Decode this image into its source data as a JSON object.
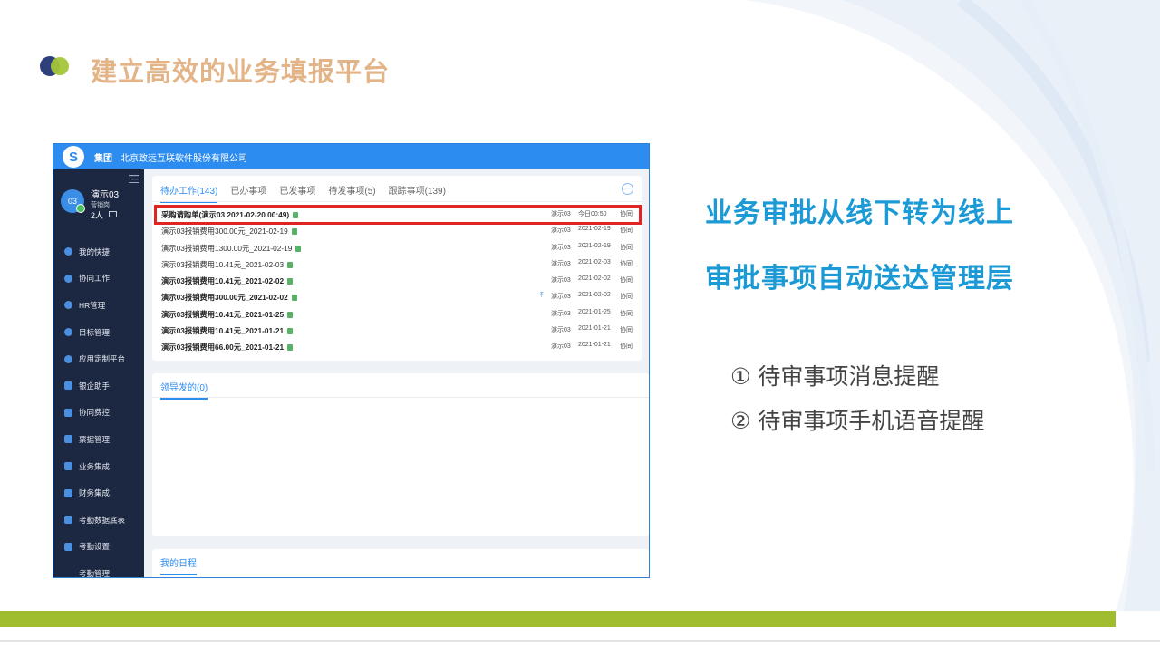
{
  "slide": {
    "title": "建立高效的业务填报平台",
    "headline_1": "业务审批从线下转为线上",
    "headline_2": "审批事项自动送达管理层",
    "bullets": [
      "① 待审事项消息提醒",
      "② 待审事项手机语音提醒"
    ]
  },
  "colors": {
    "title": "#e2b488",
    "headline": "#1b9ad6",
    "accent_bar": "#a0bd30",
    "app_blue": "#2d8cf0",
    "sidebar": "#1c2741",
    "highlight": "#e02424"
  },
  "app": {
    "logo_icon": "swirl-logo-icon",
    "group_label": "集团",
    "company": "北京致远互联软件股份有限公司",
    "user": {
      "avatar_text": "03",
      "name": "演示03",
      "dept": "营销岗",
      "count": "2人"
    },
    "menu": [
      {
        "label": "我的快捷",
        "icon": "shortcut-icon"
      },
      {
        "label": "协同工作",
        "icon": "collaboration-icon"
      },
      {
        "label": "HR管理",
        "icon": "hr-icon"
      },
      {
        "label": "目标管理",
        "icon": "target-icon"
      },
      {
        "label": "应用定制平台",
        "icon": "platform-icon"
      },
      {
        "label": "银企助手",
        "icon": "document-icon"
      },
      {
        "label": "协同费控",
        "icon": "cost-control-icon"
      },
      {
        "label": "票据管理",
        "icon": "document-icon"
      },
      {
        "label": "业务集成",
        "icon": "document-icon"
      },
      {
        "label": "财务集成",
        "icon": "document-icon"
      },
      {
        "label": "考勤数据底表",
        "icon": "cube-icon"
      },
      {
        "label": "考勤设置",
        "icon": "settings-form-icon"
      },
      {
        "label": "考勤管理",
        "icon": ""
      }
    ],
    "tabs": [
      "待办工作(143)",
      "已办事项",
      "已发事项",
      "待发事项(5)",
      "跟踪事项(139)"
    ],
    "more_label": "···",
    "pending_items": [
      {
        "subject": "采购请购单(演示03 2021-02-20 00:49)",
        "sender": "演示03",
        "date": "今日00:50",
        "category": "协同",
        "bold": true,
        "pinned": false
      },
      {
        "subject": "演示03报销费用300.00元_2021-02-19",
        "sender": "演示03",
        "date": "2021-02-19",
        "category": "协同",
        "bold": false,
        "pinned": false
      },
      {
        "subject": "演示03报销费用1300.00元_2021-02-19",
        "sender": "演示03",
        "date": "2021-02-19",
        "category": "协同",
        "bold": false,
        "pinned": false
      },
      {
        "subject": "演示03报销费用10.41元_2021-02-03",
        "sender": "演示03",
        "date": "2021-02-03",
        "category": "协同",
        "bold": false,
        "pinned": false
      },
      {
        "subject": "演示03报销费用10.41元_2021-02-02",
        "sender": "演示03",
        "date": "2021-02-02",
        "category": "协同",
        "bold": true,
        "pinned": false
      },
      {
        "subject": "演示03报销费用300.00元_2021-02-02",
        "sender": "演示03",
        "date": "2021-02-02",
        "category": "协同",
        "bold": true,
        "pinned": true
      },
      {
        "subject": "演示03报销费用10.41元_2021-01-25",
        "sender": "演示03",
        "date": "2021-01-25",
        "category": "协同",
        "bold": true,
        "pinned": false
      },
      {
        "subject": "演示03报销费用10.41元_2021-01-21",
        "sender": "演示03",
        "date": "2021-01-21",
        "category": "协同",
        "bold": true,
        "pinned": false
      },
      {
        "subject": "演示03报销费用66.00元_2021-01-21",
        "sender": "演示03",
        "date": "2021-01-21",
        "category": "协同",
        "bold": true,
        "pinned": false
      }
    ],
    "leader_tab": "领导发的(0)",
    "schedule_tab": "我的日程"
  }
}
